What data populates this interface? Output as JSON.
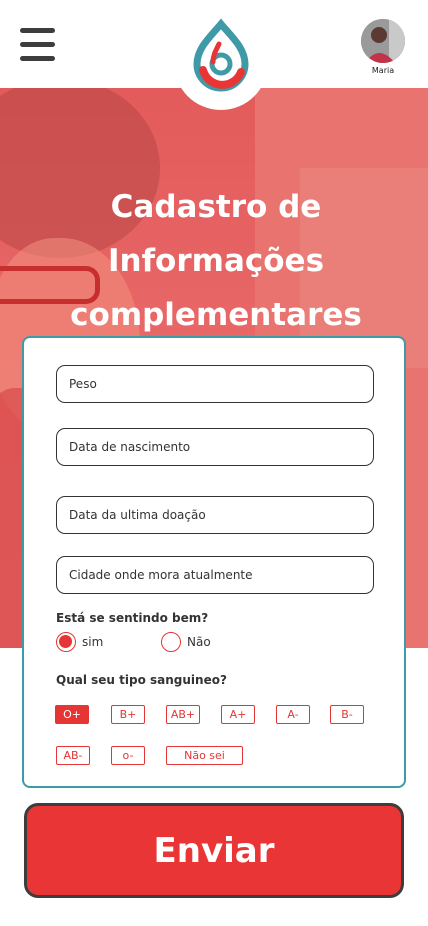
{
  "header": {
    "user_name": "Maria"
  },
  "hero": {
    "title_line1": "Cadastro de",
    "title_line2": "Informações",
    "title_line3": "complementares"
  },
  "form": {
    "weight_placeholder": "Peso",
    "birth_placeholder": "Data de nascimento",
    "last_donation_placeholder": "Data da ultima doação",
    "city_placeholder": "Cidade onde mora atualmente",
    "feeling_question": "Está se sentindo bem?",
    "feeling_options": [
      "sim",
      "Não"
    ],
    "feeling_selected": "sim",
    "blood_question": "Qual seu tipo sanguineo?",
    "blood_types": [
      "O+",
      "B+",
      "AB+",
      "A+",
      "A-",
      "B-",
      "AB-",
      "o-",
      "Não sei"
    ],
    "blood_selected": "O+"
  },
  "submit_label": "Enviar",
  "colors": {
    "primary_red": "#e93535",
    "teal": "#3e9aa6",
    "dark": "#3d3d3d"
  }
}
